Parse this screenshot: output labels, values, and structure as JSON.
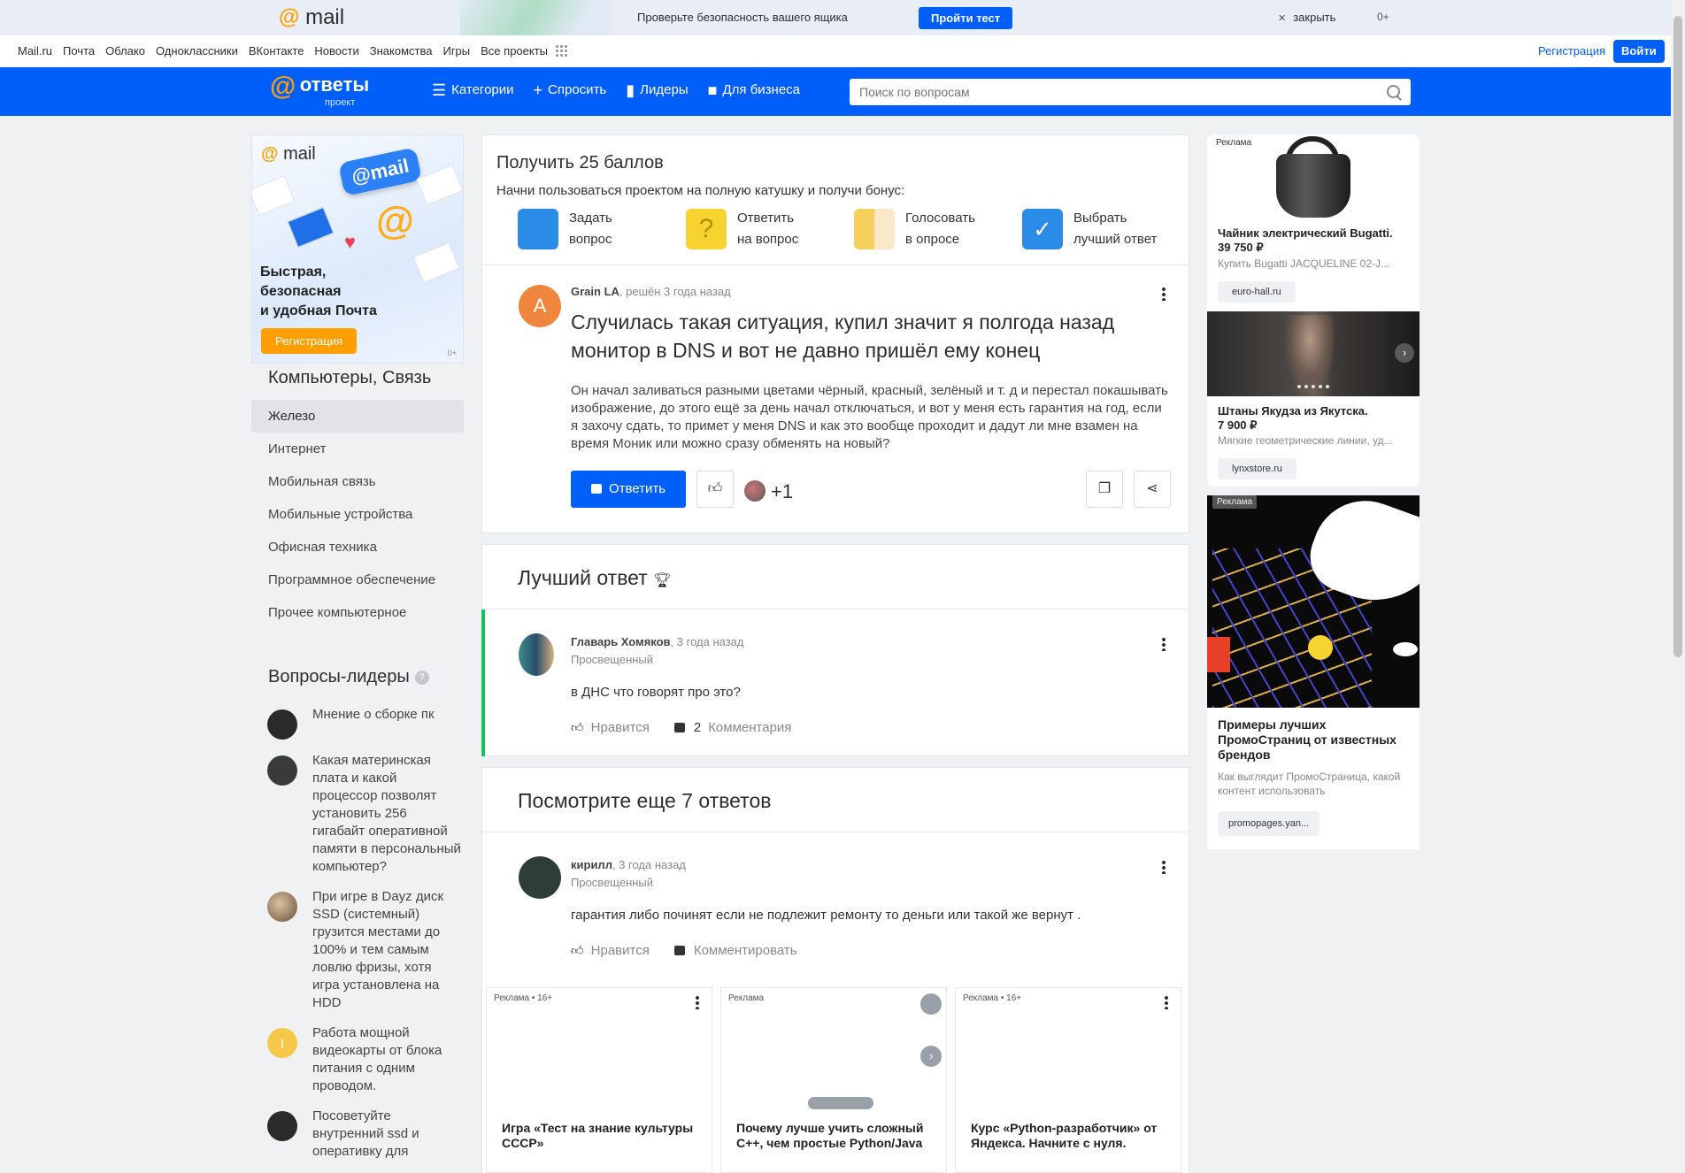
{
  "promo": {
    "logo_at": "@",
    "logo_text": "mail",
    "text": "Проверьте безопасность вашего ящика",
    "button": "Пройти тест",
    "close": "закрыть",
    "age": "0+"
  },
  "portal": {
    "links": [
      "Mail.ru",
      "Почта",
      "Облако",
      "Одноклассники",
      "ВКонтакте",
      "Новости",
      "Знакомства",
      "Игры",
      "Все проекты"
    ],
    "register": "Регистрация",
    "login": "Войти"
  },
  "header": {
    "brand": "ответы",
    "brand_sub": "проект",
    "nav": [
      {
        "label": "Категории",
        "icon": "list-icon"
      },
      {
        "label": "Спросить",
        "icon": "plus-icon"
      },
      {
        "label": "Лидеры",
        "icon": "bar-chart-icon"
      },
      {
        "label": "Для бизнеса",
        "icon": "briefcase-icon"
      }
    ],
    "search_placeholder": "Поиск по вопросам"
  },
  "left_ad": {
    "logo": "mail",
    "pill": "@mail",
    "text_lines": [
      "Быстрая,",
      "безопасная",
      "и удобная Почта"
    ],
    "button": "Регистрация",
    "age": "0+"
  },
  "categories": {
    "title": "Компьютеры, Связь",
    "items": [
      "Железо",
      "Интернет",
      "Мобильная связь",
      "Мобильные устройства",
      "Офисная техника",
      "Программное обеспечение",
      "Прочее компьютерное"
    ],
    "active_index": 0
  },
  "leaders": {
    "title": "Вопросы-лидеры",
    "items": [
      {
        "text": "Мнение о сборке пк",
        "avatar_color": "#2a2a2a"
      },
      {
        "text": "Какая материнская плата и какой процессор позволят установить 256 гигабайт оперативной памяти в персональный компьютер?",
        "avatar_color": "#3a3a3a"
      },
      {
        "text": "При игре в Dayz диск SSD (системный) грузится местами до 100% и тем самым ловлю фризы, хотя игра установлена на HDD",
        "avatar_color": "#8a6a4a"
      },
      {
        "text": "Работа мощной видеокарты от блока питания с одним проводом.",
        "avatar_color": "#f5c84a",
        "avatar_letter": "I"
      },
      {
        "text": "Посоветуйте внутренний ssd и оперативку для",
        "avatar_color": "#2b2b2b"
      }
    ]
  },
  "bonus": {
    "title": "Получить 25 баллов",
    "subtitle": "Начни пользоваться проектом на полную катушку и получи бонус:",
    "steps": [
      {
        "line1": "Задать",
        "line2": "вопрос",
        "color": "#2b8ce8"
      },
      {
        "line1": "Ответить",
        "line2": "на вопрос",
        "color": "#f7d330"
      },
      {
        "line1": "Голосовать",
        "line2": "в опросе",
        "color": "#f5d05c"
      },
      {
        "line1": "Выбрать",
        "line2": "лучший ответ",
        "color": "#2b8ce8"
      }
    ]
  },
  "question": {
    "avatar_letter": "A",
    "author": "Grain LA",
    "meta": ", решён 3 года назад",
    "title": "Случилась такая ситуация, купил значит я полгода назад монитор в DNS и вот не давно пришёл ему конец",
    "body": "Он начал заливаться разными цветами чёрный, красный, зелёный и т. д и перестал покашывать изображение, до этого ещё за день начал отключаться, и вот у меня есть гарантия на год, если я захочу сдать, то примет у меня DNS и как это вообще проходит и дадут ли мне взамен на время Моник или можно сразу обменять на новый?",
    "reply_label": "Ответить",
    "likes": "+1"
  },
  "best_answer": {
    "title": "Лучший ответ",
    "author": "Главарь Хомяков",
    "time": ", 3 года назад",
    "rank": "Просвещенный",
    "text": "в ДНС что говорят про это?",
    "like_label": "Нравится",
    "comments_count": "2",
    "comments_label": "Комментария"
  },
  "more_answers": {
    "title": "Посмотрите еще 7 ответов",
    "author": "кирилл",
    "time": ", 3 года назад",
    "rank": "Просвещенный",
    "text": "гарантия либо починят если не подлежит ремонту то деньги или такой же вернут .",
    "like_label": "Нравится",
    "comment_label": "Комментировать"
  },
  "bottom_ads": [
    {
      "label": "Реклама • 16+",
      "title": "Игра «Тест на знание культуры СССР»"
    },
    {
      "label": "Реклама",
      "title": "Почему лучше учить сложный С++, чем простые Python/Java"
    },
    {
      "label": "Реклама • 16+",
      "title": "Курс «Python-разработчик» от Яндекса. Начните с нуля."
    }
  ],
  "right_ads": {
    "label": "Реклама",
    "item1": {
      "title": "Чайник электрический Bugatti.",
      "price": "39 750 ₽",
      "desc": "Купить Bugatti JACQUELINE 02-J...",
      "domain": "euro-hall.ru"
    },
    "item2": {
      "title": "Штаны Якудза из Якутска.",
      "price": "7 900 ₽",
      "desc": "Мягкие геометрические линии, уд...",
      "domain": "lynxstore.ru"
    },
    "item3": {
      "label": "Реклама",
      "title": "Примеры лучших ПромоСтраниц от известных брендов",
      "desc": "Как выглядит ПромоСтраница, какой контент использовать",
      "domain": "promopages.yan..."
    }
  },
  "colors": {
    "brand_blue": "#005ff9",
    "accent_orange": "#ff9e00",
    "best_answer_green": "#16c25a"
  }
}
